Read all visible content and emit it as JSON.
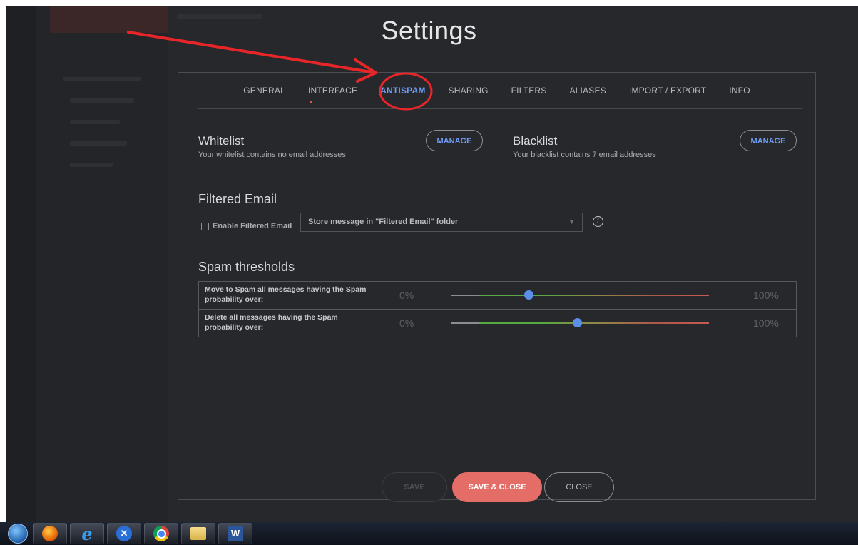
{
  "window_title": "Settings",
  "tabs": [
    {
      "label": "GENERAL",
      "active": false
    },
    {
      "label": "INTERFACE",
      "active": false
    },
    {
      "label": "ANTISPAM",
      "active": true
    },
    {
      "label": "SHARING",
      "active": false
    },
    {
      "label": "FILTERS",
      "active": false
    },
    {
      "label": "ALIASES",
      "active": false
    },
    {
      "label": "IMPORT / EXPORT",
      "active": false
    },
    {
      "label": "INFO",
      "active": false
    }
  ],
  "whitelist": {
    "title": "Whitelist",
    "description": "Your whitelist contains no email addresses",
    "button": "MANAGE"
  },
  "blacklist": {
    "title": "Blacklist",
    "description": "Your blacklist contains 7 email addresses",
    "button": "MANAGE"
  },
  "filtered_email": {
    "title": "Filtered Email",
    "checkbox_label": "Enable Filtered Email",
    "checked": false,
    "select_value": "Store message in \"Filtered Email\" folder"
  },
  "spam_thresholds": {
    "title": "Spam thresholds",
    "rows": [
      {
        "label": "Move to Spam all messages having the Spam probability over:",
        "min": "0%",
        "max": "100%",
        "value_fraction": 0.3
      },
      {
        "label": "Delete all messages having the Spam probability over:",
        "min": "0%",
        "max": "100%",
        "value_fraction": 0.49
      }
    ]
  },
  "footer": {
    "save": "SAVE",
    "save_close": "SAVE & CLOSE",
    "close": "CLOSE"
  },
  "colors": {
    "accent": "#6f9cf5",
    "primary_button": "#e46e67",
    "annotation": "#e8262a"
  },
  "taskbar": {
    "apps": [
      "windows-start-icon",
      "firefox-icon",
      "internet-explorer-icon",
      "xmarks-icon",
      "chrome-icon",
      "file-explorer-icon",
      "word-icon"
    ]
  }
}
